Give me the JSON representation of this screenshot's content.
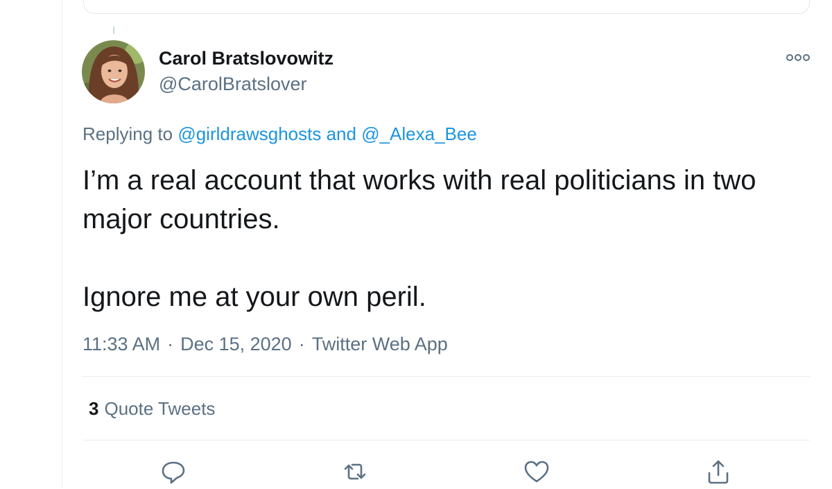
{
  "tweet": {
    "author": {
      "display_name": "Carol Bratslovowitz",
      "handle": "@CarolBratslover"
    },
    "replying_to": {
      "prefix": "Replying to",
      "mention_1": "@girldrawsghosts",
      "conjunction": "and",
      "mention_2": "@_Alexa_Bee"
    },
    "text": "I’m a real account that works with real politicians in two major countries.\n\nIgnore me at your own peril.",
    "time": "11:33 AM",
    "separator": "·",
    "date": "Dec 15, 2020",
    "source": "Twitter Web App",
    "quote_tweets": {
      "count": "3",
      "label": "Quote Tweets"
    }
  },
  "icons": {
    "more": "more-options-icon",
    "reply": "reply-icon",
    "retweet": "retweet-icon",
    "like": "like-icon",
    "share": "share-icon"
  },
  "colors": {
    "link": "#1b95e0",
    "secondary_text": "#5b7083",
    "primary_text": "#14171a",
    "divider": "#e6ecf0"
  }
}
